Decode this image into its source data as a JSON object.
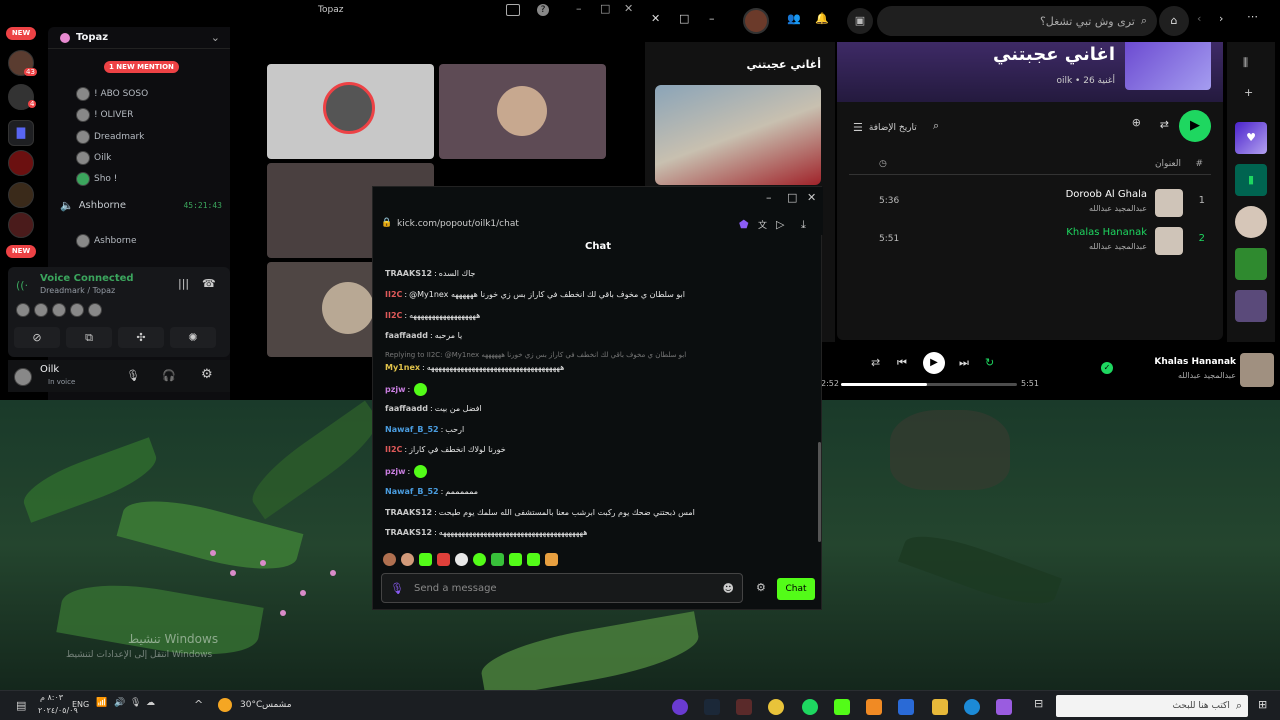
{
  "discord": {
    "title": "Topaz",
    "server_name": "Topaz",
    "new_badge": "NEW",
    "new_mention": "1 NEW MENTION",
    "unread_counts": [
      "43",
      "4"
    ],
    "voice_users": [
      "! ABO SOSO",
      "! OLIVER",
      "Dreadmark",
      "Oilk",
      "Sho !"
    ],
    "channel_2": "Ashborne",
    "channel_2_timer": "45:21:43",
    "channel_2_users": [
      "Ashborne"
    ],
    "voice_status": "Voice Connected",
    "voice_sub": "Dreadmark / Topaz",
    "user_name": "Oilk",
    "user_status": "In voice"
  },
  "kick": {
    "url": "kick.com/popout/oilk1/chat",
    "header": "Chat",
    "messages": [
      {
        "user": "TRAAKS12",
        "color": "#c9c9c9",
        "text": "جاك السده"
      },
      {
        "user": "II2C",
        "color": "#e05a5a",
        "text": "@My1nex ابو سلطان ي مخوف باقي لك انخطف في كاراز بس زي خورنا ههههههه"
      },
      {
        "user": "II2C",
        "color": "#e05a5a",
        "text": "ههههههههههههههههههه"
      },
      {
        "user": "faaffaadd",
        "color": "#c9c9c9",
        "text": "يا مرحبه"
      },
      {
        "user": "My1nex",
        "color": "#e0c24a",
        "text": "ههههههههههههههههههههههههههههههههههههه"
      },
      {
        "user": "pzjw",
        "color": "#c97ee0",
        "text": ""
      },
      {
        "user": "faaffaadd",
        "color": "#c9c9c9",
        "text": "افضل من بيت"
      },
      {
        "user": "Nawaf_B_52",
        "color": "#4a9de0",
        "text": "ارحب"
      },
      {
        "user": "II2C",
        "color": "#e05a5a",
        "text": "خورنا لولاك انخطف في كاراز"
      },
      {
        "user": "pzjw",
        "color": "#c97ee0",
        "text": ""
      },
      {
        "user": "Nawaf_B_52",
        "color": "#4a9de0",
        "text": "ممممممم"
      },
      {
        "user": "TRAAKS12",
        "color": "#c9c9c9",
        "text": "امس ذبحتني ضحك يوم ركبت ابرشب معنا بالمستشفى الله سلمك يوم طيحت"
      },
      {
        "user": "TRAAKS12",
        "color": "#c9c9c9",
        "text": "هههههههههههههههههههههههههههههههههههههههه"
      }
    ],
    "reply_line": "Replying to II2C: @My1nex ابو سلطان ي مخوف باقي لك انخطف في كاراز بس زي خورنا ههههههه",
    "input_placeholder": "Send a message",
    "send_label": "Chat"
  },
  "spotify": {
    "search_placeholder": "ترى وش تبي تشغل؟",
    "playlist_title": "اغاني عجبتني",
    "playlist_meta": "oilk • 26 أغنية",
    "sort_label": "تاريخ الإضافة",
    "col_hash": "#",
    "col_title": "العنوان",
    "tracks": [
      {
        "num": "1",
        "title": "Doroob Al Ghala",
        "artist": "عبدالمجيد عبدالله",
        "duration": "5:36",
        "active": false
      },
      {
        "num": "2",
        "title": "Khalas Hananak",
        "artist": "عبدالمجيد عبدالله",
        "duration": "5:51",
        "active": true
      }
    ],
    "panel_title": "أغاني عجبتني",
    "now_playing_title": "Khalas Hananak",
    "now_playing_artist": "عبدالمجيد عبدالله",
    "elapsed": "2:52",
    "total": "5:51",
    "progress": 0.49
  },
  "desktop": {
    "watermark_1": "تنشيط Windows",
    "watermark_2": "انتقل إلى الإعدادات لتنشيط Windows"
  },
  "taskbar": {
    "search_placeholder": "اكتب هنا للبحث",
    "weather_temp": "30°C",
    "weather_text": "مشمس",
    "lang": "ENG",
    "time": "٨:٠٣ م",
    "date": "٢٠٢٤/٠٥/٠٩"
  }
}
